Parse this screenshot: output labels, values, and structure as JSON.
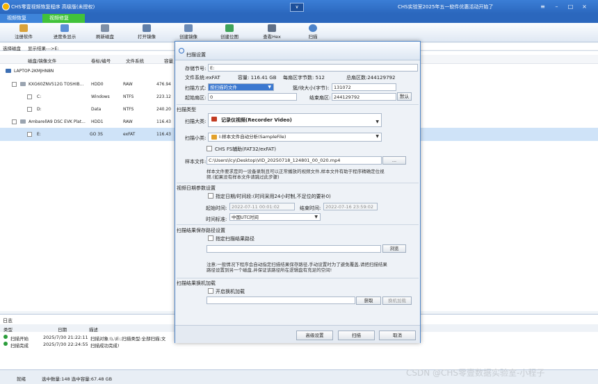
{
  "app": {
    "title": "CHS零壹视频恢复程序 高级版(未授权)",
    "promo": "CHS实验室2025年五一软件优惠活动开始了",
    "dropdown": "∨"
  },
  "tabs": [
    "视频恢复",
    "视频修复"
  ],
  "toolbar": [
    "注册软件",
    "进度条显示",
    "刷新磁盘",
    "打开镜像",
    "创建镜像",
    "创建位图",
    "查看Hex",
    "扫描"
  ],
  "pathbar": {
    "left": "选择磁盘",
    "crumb": "显示结果--->E:"
  },
  "disk_table": {
    "headers": [
      "磁盘/镜像文件",
      "卷标/编号",
      "文件系统",
      "容量"
    ],
    "rows": [
      {
        "name": "LAPTOP-2KMJHN8N",
        "label": "",
        "fs": "",
        "cap": ""
      },
      {
        "name": "KXG60ZNV512G TOSHIB...",
        "label": "HDD0",
        "fs": "RAW",
        "cap": "476.94"
      },
      {
        "name": "C:",
        "label": "Windows",
        "fs": "NTFS",
        "cap": "223.12"
      },
      {
        "name": "D:",
        "label": "Data",
        "fs": "NTFS",
        "cap": "240.20"
      },
      {
        "name": "AmbarellA9 DSC EVK Plat...",
        "label": "HDD1",
        "fs": "RAW",
        "cap": "116.43"
      },
      {
        "name": "E:",
        "label": "GO 3S",
        "fs": "exFAT",
        "cap": "116.43"
      }
    ]
  },
  "log": {
    "title": "日志",
    "headers": [
      "类型",
      "日期",
      "描述"
    ],
    "rows": [
      {
        "type": "扫描开始",
        "date": "2025/7/30 21:22:11",
        "desc": "扫描对象:\\\\.\\E:;扫描类型:全部扫描;文"
      },
      {
        "type": "扫描完成",
        "date": "2025/7/30 22:24:55",
        "desc": "扫描成功完成!"
      }
    ]
  },
  "status": {
    "state": "就绪",
    "count": "选中数量:148 选中容量:67.48 GB"
  },
  "watermark": "CSDN @CHS零壹数据实验室-小程子",
  "dialog": {
    "title": "扫描设置",
    "device_label": "存储节号:",
    "device_value": "E:",
    "fs_text": "文件系统:exFAT",
    "cap_text": "容量: 116.41 GB",
    "sector_text": "每扇区字节数: 512",
    "total_text": "总扇区数:244129792",
    "scan_mode_label": "扫描方式:",
    "scan_mode_value": "按扫描的文件",
    "cluster_label": "簇/块大小(字节):",
    "cluster_value": "131072",
    "start_label": "起始扇区:",
    "start_value": "0",
    "end_label": "结束扇区:",
    "end_value": "244129792",
    "default_btn": "默认",
    "section_type": "扫描类型",
    "major_label": "扫描大类:",
    "major_value": "记录仪视频(Recorder Video)",
    "minor_label": "扫描小类:",
    "minor_value": "I:样本文件自动分析(SampleFile)",
    "fs_assist": "CHS FS辅助(FAT32/exFAT)",
    "sample_label": "样本文件:",
    "sample_value": "C:\\Users\\lcy\\Desktop\\VID_20250718_124801_00_020.mp4",
    "browse_dots": "...",
    "sample_note": "样本文件要求是同一设备录制且可以正常播放的视频文件,样本文件有助于程序精确定位视频.(如果没有样本文件请跳过此步骤)",
    "section_date": "视频日期参数设置",
    "date_check": "指定日期/时间段:(时间采用24小时制,不足位的要补0)",
    "start_time_label": "起始时间:",
    "start_time_value": "2022-07-11 00:01:02",
    "end_time_label": "结束时间:",
    "end_time_value": "2022-07-16 23:59:02",
    "tz_label": "时间标准:",
    "tz_value": "中国UTC时间",
    "section_path": "扫描结果保存路径设置",
    "path_check": "指定扫描结果路径",
    "browse_btn": "浏览",
    "path_note": "注意:一般情况下程序会自动指定扫描结果保存路径,手动设置时为了避免覆盖,请把扫描结果路径设置到另一个磁盘,并保证该路径所在逻辑盘有充足的空间!",
    "section_resume": "扫描结果换机加载",
    "resume_check": "开启换机加载",
    "get_btn": "获取",
    "load_btn": "换机加载",
    "adv_btn": "高级设置",
    "scan_btn": "扫描",
    "cancel_btn": "取消"
  }
}
